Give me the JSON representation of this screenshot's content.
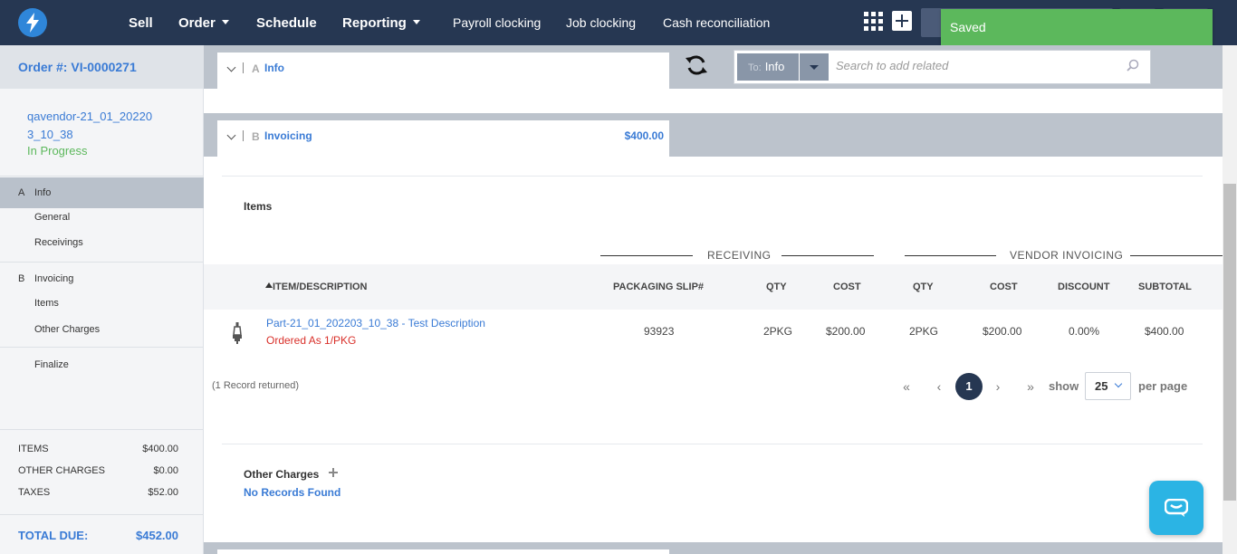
{
  "nav": {
    "items": [
      {
        "label": "Sell",
        "dropdown": false
      },
      {
        "label": "Order",
        "dropdown": true
      },
      {
        "label": "Schedule",
        "dropdown": false
      },
      {
        "label": "Reporting",
        "dropdown": true
      },
      {
        "label": "Payroll clocking",
        "dropdown": false
      },
      {
        "label": "Job clocking",
        "dropdown": false
      },
      {
        "label": "Cash reconciliation",
        "dropdown": false
      }
    ],
    "icons": [
      "logo-bolt-icon",
      "apps-grid-icon",
      "add-plus-icon"
    ],
    "toast": "Saved",
    "colors": {
      "bar": "#263752",
      "toast": "#5cb85c",
      "accent": "#3a7bd5"
    }
  },
  "sidebar": {
    "order_label": "Order #: VI-0000271",
    "vendor_line1": "qavendor-21_01_20220",
    "vendor_line2": "3_10_38",
    "status": "In Progress",
    "sections": [
      {
        "letter": "A",
        "label": "Info",
        "active": true,
        "subs": [
          "General",
          "Receivings"
        ]
      },
      {
        "letter": "B",
        "label": "Invoicing",
        "active": false,
        "subs": [
          "Items",
          "Other Charges"
        ]
      },
      {
        "letter": "",
        "label": "Finalize",
        "active": false,
        "subs": []
      }
    ],
    "totals": [
      {
        "label": "ITEMS",
        "value": "$400.00"
      },
      {
        "label": "OTHER CHARGES",
        "value": "$0.00"
      },
      {
        "label": "TAXES",
        "value": "$52.00"
      }
    ],
    "total_due_label": "TOTAL DUE:",
    "total_due_value": "$452.00"
  },
  "main": {
    "section_a": {
      "letter": "A",
      "label": "Info"
    },
    "section_b": {
      "letter": "B",
      "label": "Invoicing",
      "amount": "$400.00"
    },
    "related": {
      "to_prefix": "To:",
      "to_value": "Info",
      "placeholder": "Search to add related"
    },
    "items_title": "Items",
    "groups": {
      "receiving": "RECEIVING",
      "vendor_invoicing": "VENDOR INVOICING"
    },
    "columns": [
      "ITEM/DESCRIPTION",
      "PACKAGING SLIP#",
      "QTY",
      "COST",
      "QTY",
      "COST",
      "DISCOUNT",
      "SUBTOTAL"
    ],
    "rows": [
      {
        "part": "Part-21_01_202203_10_38 - Test Description",
        "ordered_as": "Ordered As 1/PKG",
        "packaging_slip": "93923",
        "recv_qty": "2PKG",
        "recv_cost": "$200.00",
        "inv_qty": "2PKG",
        "inv_cost": "$200.00",
        "discount": "0.00%",
        "subtotal": "$400.00"
      }
    ],
    "records_returned": "(1 Record returned)",
    "pagination": {
      "first": "«",
      "prev": "‹",
      "current": "1",
      "next": "›",
      "last": "»",
      "show": "show",
      "per_page_value": "25",
      "per_page": "per page"
    },
    "other_charges_title": "Other Charges",
    "no_records": "No Records Found"
  }
}
